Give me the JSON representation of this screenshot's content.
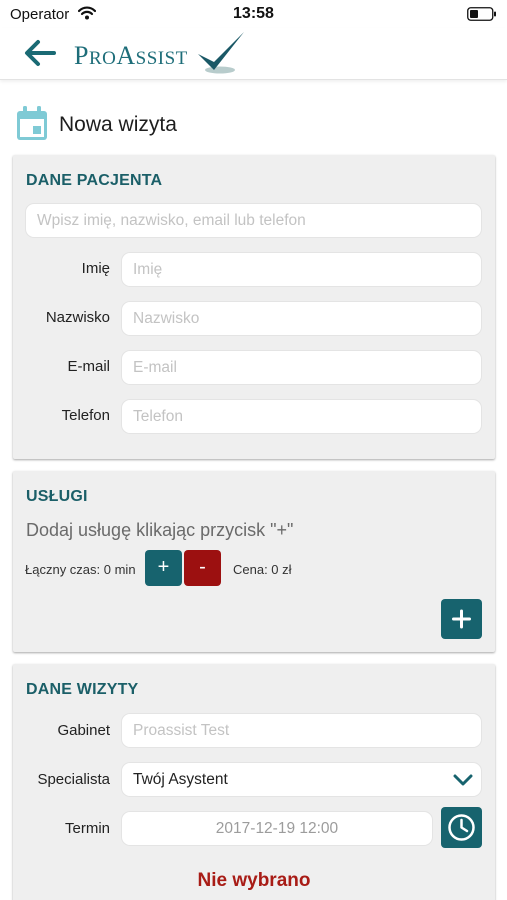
{
  "status_bar": {
    "carrier": "Operator",
    "time": "13:58",
    "wifi_icon": "wifi-icon",
    "battery_icon": "battery-icon"
  },
  "header": {
    "back_icon": "arrow-left-icon",
    "logo_text_first": "P",
    "logo_text_mid": "RO",
    "logo_text_a": "A",
    "logo_text_rest": "SSIST",
    "brand_color": "#1d6d79"
  },
  "page": {
    "icon": "calendar-icon",
    "title": "Nowa wizyta"
  },
  "patient": {
    "title": "DANE PACJENTA",
    "search_placeholder": "Wpisz imię, nazwisko, email lub telefon",
    "fields": [
      {
        "label": "Imię",
        "placeholder": "Imię"
      },
      {
        "label": "Nazwisko",
        "placeholder": "Nazwisko"
      },
      {
        "label": "E-mail",
        "placeholder": "E-mail"
      },
      {
        "label": "Telefon",
        "placeholder": "Telefon"
      }
    ]
  },
  "services": {
    "title": "USŁUGI",
    "hint": "Dodaj usługę klikając przycisk \"+\"",
    "total_time": "Łączny czas: 0 min",
    "plus_label": "+",
    "minus_label": "-",
    "price": "Cena: 0 zł",
    "add_icon": "plus-icon"
  },
  "visit": {
    "title": "DANE WIZYTY",
    "office_label": "Gabinet",
    "office_placeholder": "Proassist Test",
    "specialist_label": "Specialista",
    "specialist_value": "Twój Asystent",
    "term_label": "Termin",
    "term_value": "2017-12-19 12:00",
    "clock_icon": "clock-icon",
    "status": "Nie wybrano"
  },
  "colors": {
    "accent": "#17636e",
    "danger": "#9c1010",
    "status_red": "#a81c16",
    "card_bg": "#efefef",
    "calendar_icon": "#7fcad5"
  }
}
